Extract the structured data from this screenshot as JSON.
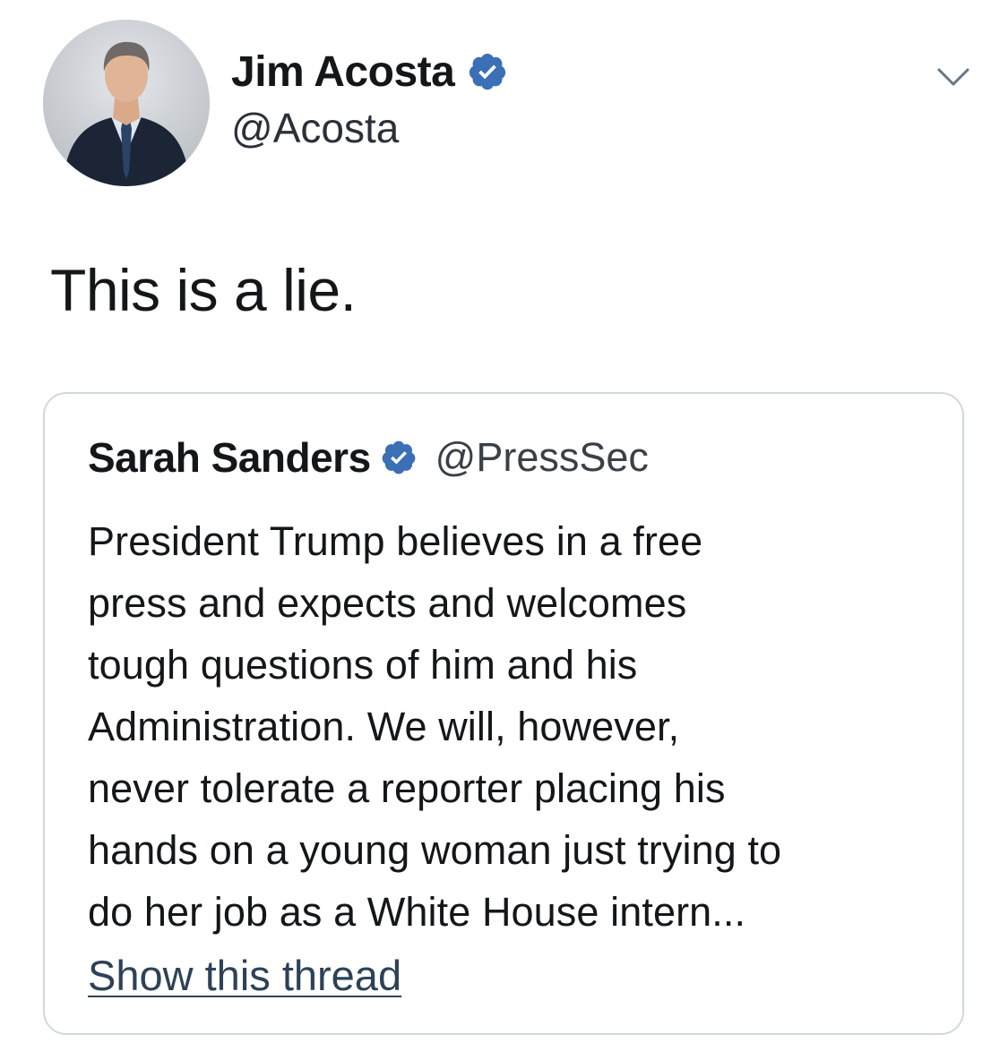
{
  "tweet": {
    "author": {
      "display_name": "Jim Acosta",
      "handle": "@Acosta",
      "verified": true
    },
    "text": "This is a lie.",
    "menu_icon": "chevron-down-icon"
  },
  "quoted_tweet": {
    "author": {
      "display_name": "Sarah Sanders",
      "handle": "@PressSec",
      "verified": true
    },
    "text_lines": [
      "President Trump believes in a free",
      "press and expects and welcomes",
      "tough questions of him and his",
      "Administration. We will, however,",
      "never tolerate a reporter placing his",
      "hands on a young woman just trying to",
      "do her job as a White House intern..."
    ],
    "show_thread_label": "Show this thread"
  },
  "colors": {
    "verified_badge": "#3b6fb6",
    "link": "#2d4256",
    "card_border": "#cfd9de"
  }
}
